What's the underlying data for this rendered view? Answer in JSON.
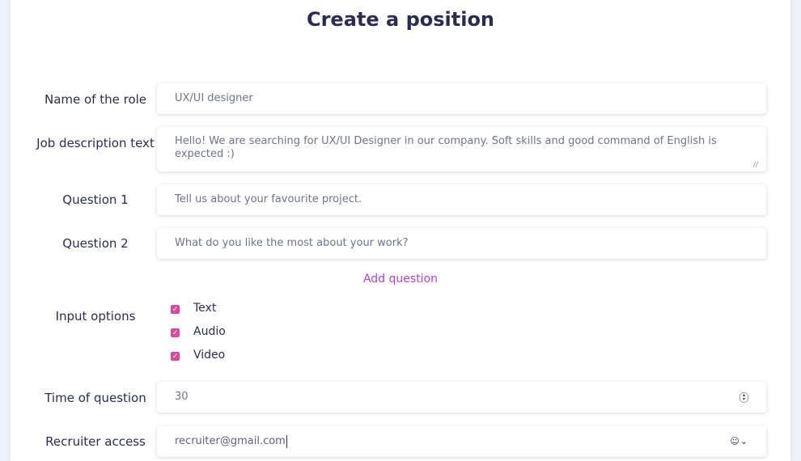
{
  "page": {
    "title": "Create a position"
  },
  "form": {
    "role_name": {
      "label": "Name of the role",
      "value": "UX/UI designer"
    },
    "job_description": {
      "label": "Job description text",
      "value": "Hello! We are searching for UX/UI Designer in our company. Soft skills and good command of English is expected :)"
    },
    "questions": [
      {
        "label": "Question 1",
        "value": "Tell us about your favourite project."
      },
      {
        "label": "Question 2",
        "value": "What do you like the most about your work?"
      }
    ],
    "add_question_label": "Add question",
    "input_options": {
      "label": "Input options",
      "options": [
        {
          "label": "Text",
          "checked": true
        },
        {
          "label": "Audio",
          "checked": true
        },
        {
          "label": "Video",
          "checked": true
        }
      ]
    },
    "time_of_question": {
      "label": "Time of question",
      "value": "30"
    },
    "recruiter_access": {
      "label": "Recruiter access",
      "value": "recruiter@gmail.com"
    }
  },
  "colors": {
    "accent": "#b540cf",
    "checkbox": "#e0479b",
    "heading": "#2a2c55"
  },
  "icons": {
    "checkmark": "check-icon",
    "number_spinner": "spinner-icon",
    "contact": "contact-icon",
    "dropdown": "chevron-down-icon",
    "resize": "resize-handle-icon"
  }
}
